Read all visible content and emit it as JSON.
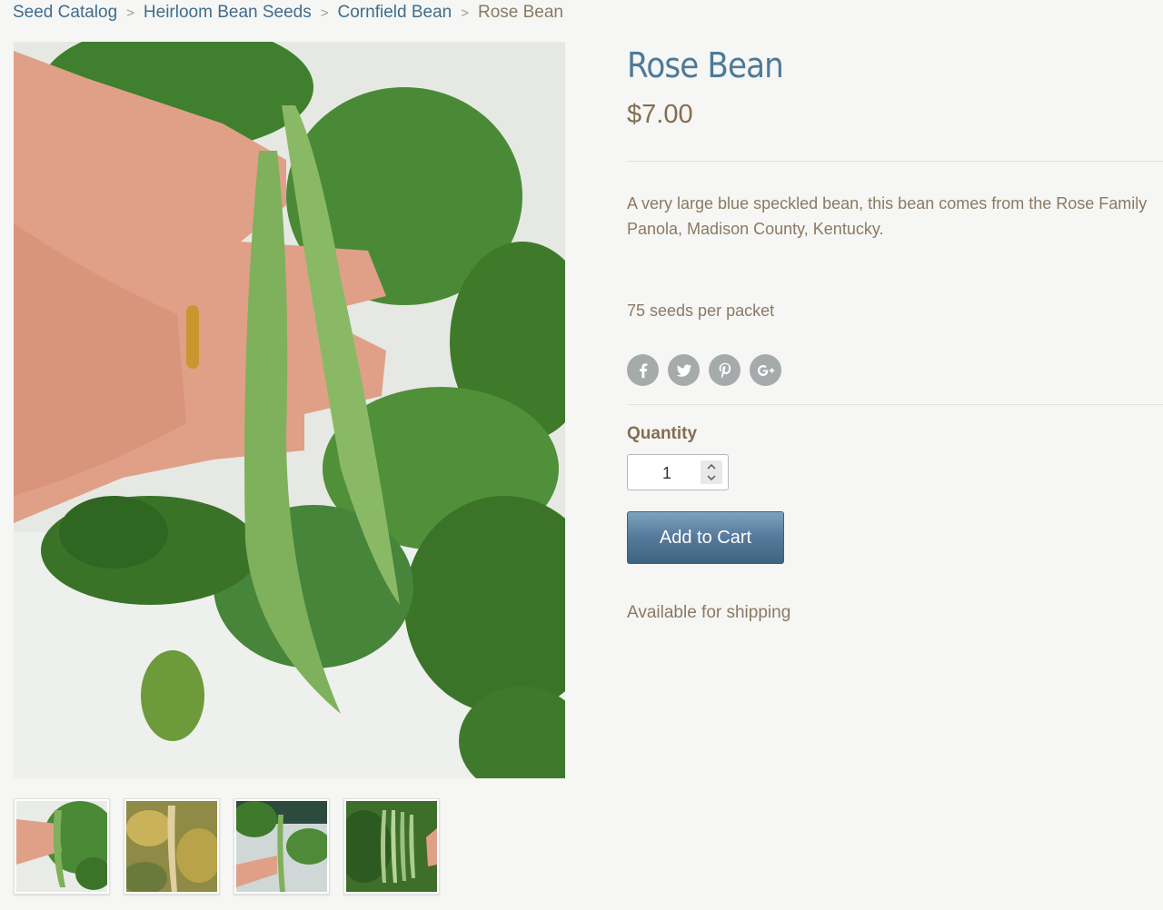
{
  "breadcrumb": {
    "items": [
      "Seed Catalog",
      "Heirloom Bean Seeds",
      "Cornfield Bean"
    ],
    "separator": ">",
    "current": "Rose Bean"
  },
  "product": {
    "title": "Rose Bean",
    "price": "$7.00",
    "description_line1": "A very large blue speckled bean, this bean comes from the Rose Family",
    "description_line2": "Panola, Madison County, Kentucky.",
    "seeds_per_packet": "75 seeds per packet",
    "quantity_label": "Quantity",
    "quantity_value": "1",
    "add_to_cart_label": "Add to Cart",
    "availability": "Available for shipping"
  },
  "social": {
    "icons": [
      "facebook-icon",
      "twitter-icon",
      "pinterest-icon",
      "google-plus-icon"
    ]
  },
  "images": {
    "main": "photo of hand holding two green bean pods among leaves",
    "thumbnails": [
      "green-pods-thumbnail",
      "dried-pods-thumbnail",
      "pod-on-vine-thumbnail",
      "bean-bunch-thumbnail"
    ]
  },
  "colors": {
    "link": "#3f6d8e",
    "title": "#4d7a98",
    "price": "#846e52",
    "text": "#8a7a63",
    "button_top": "#7da3bf",
    "button_bottom": "#3f6380",
    "social_icon_bg": "#a5aaab"
  }
}
